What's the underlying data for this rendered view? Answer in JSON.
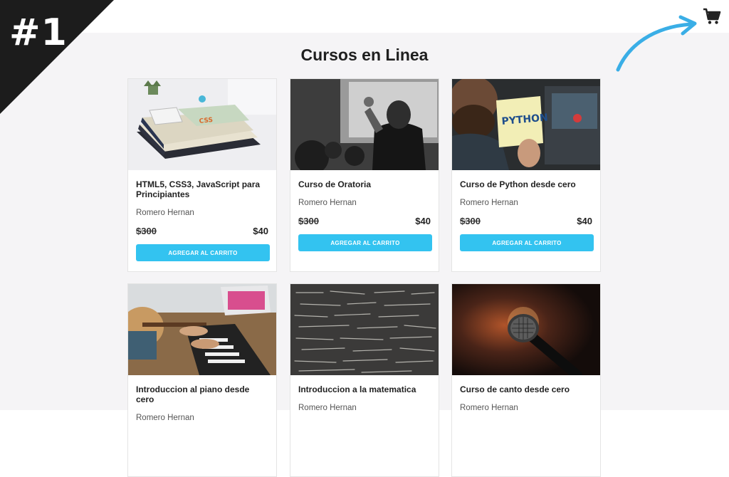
{
  "badge": "#1",
  "header": {
    "title": "Cursos en Linea"
  },
  "colors": {
    "accent": "#33c3f0",
    "corner": "#1c1c1c",
    "background": "#f5f4f6",
    "arrow": "#3aaee6"
  },
  "cart": {
    "icon": "shopping-cart-icon"
  },
  "courses": [
    {
      "title": "HTML5, CSS3, JavaScript para Principiantes",
      "author": "Romero Hernan",
      "old_price": "$300",
      "price": "$40",
      "button": "AGREGAR AL CARRITO",
      "image": "books-desk-photo"
    },
    {
      "title": "Curso de Oratoria",
      "author": "Romero Hernan",
      "old_price": "$300",
      "price": "$40",
      "button": "AGREGAR AL CARRITO",
      "image": "audience-raising-hand-photo"
    },
    {
      "title": "Curso de Python desde cero",
      "author": "Romero Hernan",
      "old_price": "$300",
      "price": "$40",
      "button": "AGREGAR AL CARRITO",
      "image": "python-sticky-note-photo"
    },
    {
      "title": "Introduccion al piano desde cero",
      "author": "Romero Hernan",
      "image": "piano-guitar-photo"
    },
    {
      "title": "Introduccion a la matematica",
      "author": "Romero Hernan",
      "image": "math-chalkboard-photo"
    },
    {
      "title": "Curso de canto desde cero",
      "author": "Romero Hernan",
      "image": "microphone-photo"
    }
  ]
}
